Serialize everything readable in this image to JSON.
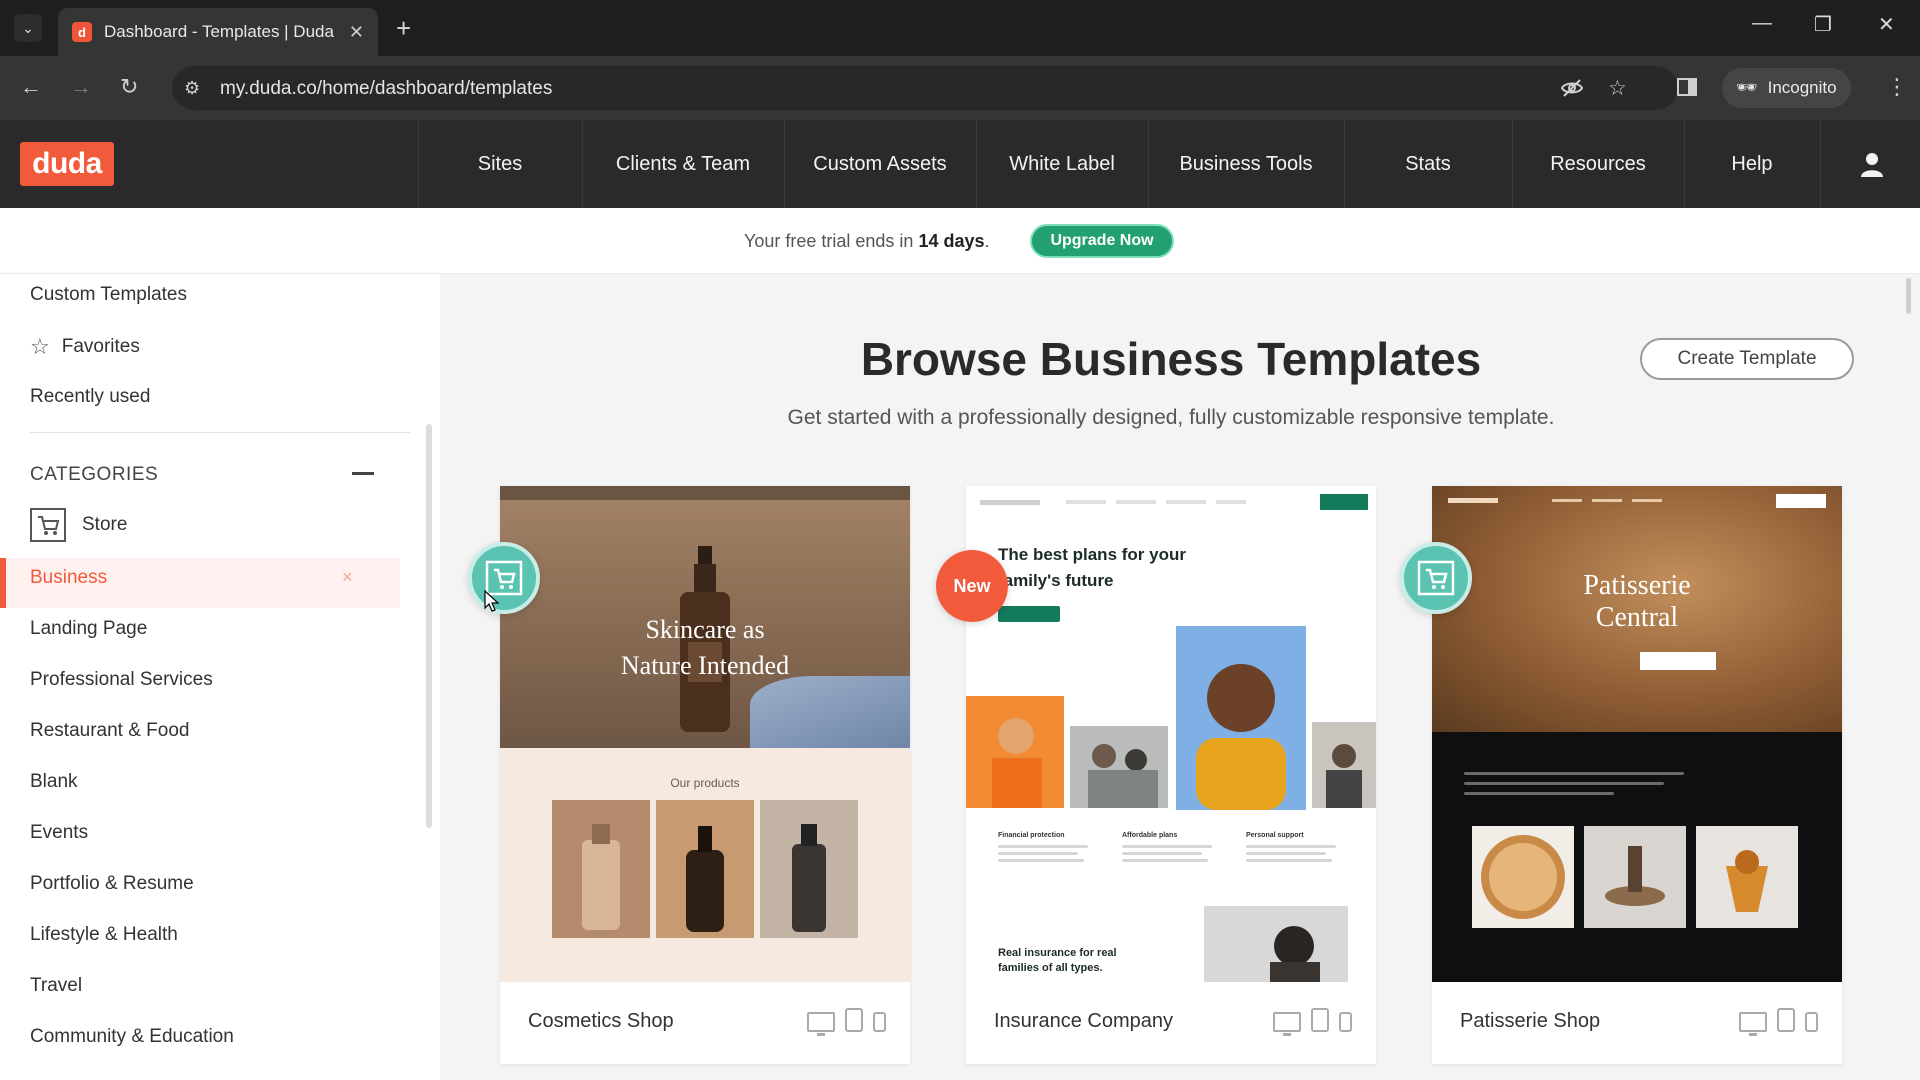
{
  "browser": {
    "tab_title": "Dashboard - Templates | Duda",
    "favicon_letter": "d",
    "url": "my.duda.co/home/dashboard/templates",
    "incognito_label": "Incognito",
    "icons": [
      "tab-dropdown-icon",
      "close-icon",
      "new-tab-icon",
      "minimize-icon",
      "restore-icon",
      "window-close-icon",
      "back-icon",
      "forward-icon",
      "reload-icon",
      "site-settings-icon",
      "eye-off-icon",
      "star-icon",
      "side-panel-icon",
      "incognito-icon",
      "more-icon"
    ]
  },
  "app": {
    "logo": "duda",
    "nav": [
      "Sites",
      "Clients & Team",
      "Custom Assets",
      "White Label",
      "Business Tools",
      "Stats",
      "Resources",
      "Help"
    ],
    "brand_color": "#f25a3c",
    "accent_green": "#22a071"
  },
  "trial": {
    "prefix": "Your free trial ends in",
    "days": "14 days",
    "suffix": ".",
    "upgrade_label": "Upgrade Now"
  },
  "sidebar": {
    "top_items": [
      "Custom Templates",
      "Favorites",
      "Recently used"
    ],
    "categories_label": "CATEGORIES",
    "store_label": "Store",
    "active_label": "Business",
    "active_clear": "×",
    "items": [
      "Landing Page",
      "Professional Services",
      "Restaurant & Food",
      "Blank",
      "Events",
      "Portfolio & Resume",
      "Lifestyle & Health",
      "Travel",
      "Community & Education"
    ]
  },
  "main": {
    "title": "Browse Business Templates",
    "subtitle": "Get started with a professionally designed, fully customizable responsive template.",
    "create_label": "Create Template",
    "cards": [
      {
        "name": "Cosmetics Shop",
        "badge": "store",
        "hero_line1": "Skincare as",
        "hero_line2": "Nature Intended",
        "section_title": "Our products"
      },
      {
        "name": "Insurance Company",
        "badge": "New",
        "headline": "The best plans for your family's future",
        "features": [
          "Financial protection",
          "Affordable plans",
          "Personal support"
        ],
        "bottom_text": "Real insurance for real families of all types."
      },
      {
        "name": "Patisserie Shop",
        "badge": "store",
        "hero_line1": "Patisserie",
        "hero_line2": "Central"
      }
    ]
  }
}
